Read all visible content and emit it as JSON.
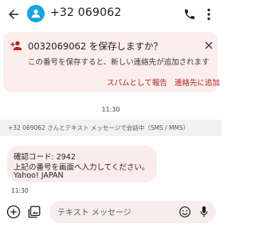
{
  "header": {
    "title": "+32 069062",
    "icons": [
      "back-arrow-icon",
      "person-avatar-icon",
      "phone-icon",
      "more-vert-icon"
    ],
    "avatar_color": "#1aa3e0"
  },
  "save_card": {
    "title": "0032069062 を保存しますか？",
    "description": "この番号を保存すると、新しい連絡先が追加されます",
    "spam_button": "スパムとして報告",
    "add_button": "連絡先に追加",
    "accent": "#b3261e",
    "background": "#fbeeed"
  },
  "conversation": {
    "timestamp_top": "11:30",
    "banner": "+32 069062 さんとテキスト メッセージで会話中（SMS / MMS）",
    "message": {
      "lines": [
        "確認コード: 2942",
        "上記の番号を画面へ入力してください。",
        "Yahoo! JAPAN"
      ],
      "time": "11:30"
    }
  },
  "composer": {
    "placeholder": "テキスト メッセージ",
    "icons": [
      "add-icon",
      "gallery-icon",
      "emoji-icon",
      "mic-icon"
    ]
  }
}
